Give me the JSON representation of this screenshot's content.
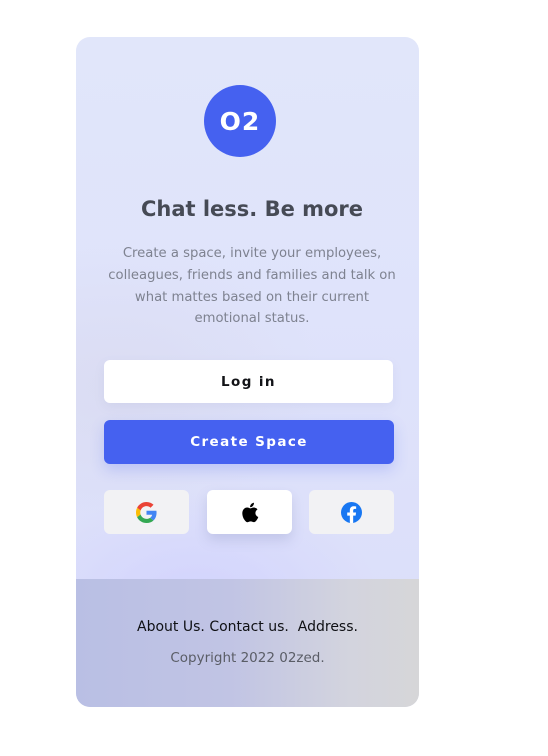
{
  "brand": {
    "logo_text": "O2",
    "accent_color": "#4561f0"
  },
  "hero": {
    "title": "Chat less. Be more",
    "description": "Create a space, invite your employees, colleagues, friends and families and talk on what mattes based on their current emotional status."
  },
  "buttons": {
    "login_label": "Log in",
    "create_label": "Create Space"
  },
  "social": [
    {
      "name": "google",
      "icon": "google-icon"
    },
    {
      "name": "apple",
      "icon": "apple-icon"
    },
    {
      "name": "facebook",
      "icon": "facebook-icon"
    }
  ],
  "footer": {
    "about": "About Us.",
    "contact": "Contact us.",
    "address": "Address.",
    "copyright": "Copyright 2022 02zed."
  }
}
